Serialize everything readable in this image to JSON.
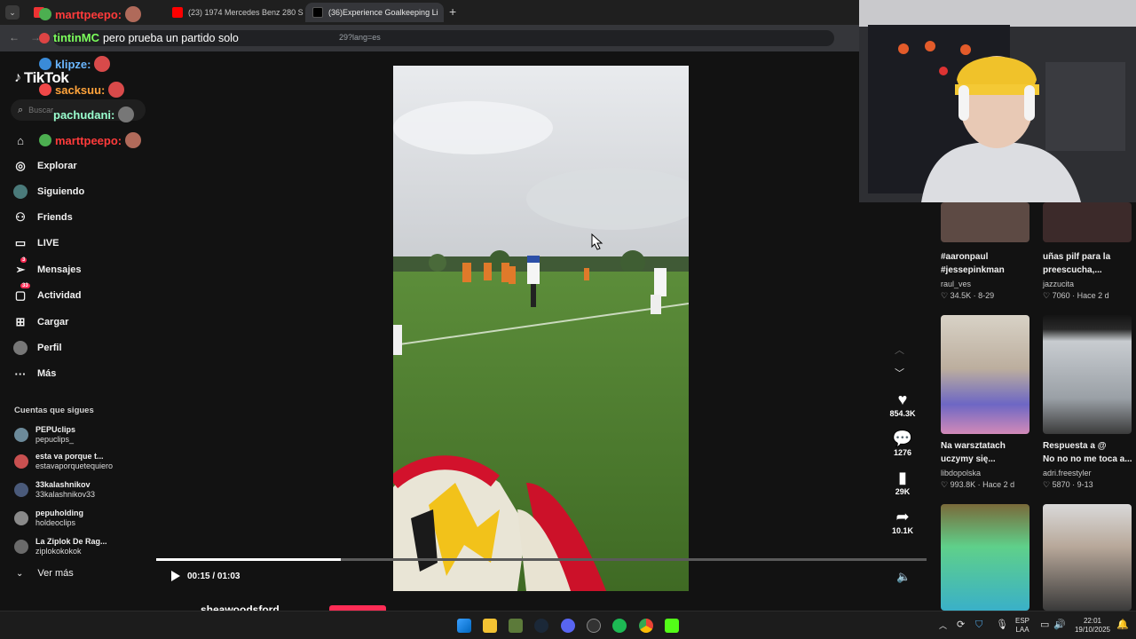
{
  "browser": {
    "tabs": [
      {
        "label": "(23) 1974 Mercedes Benz 280 S",
        "active": false
      },
      {
        "label": "(36)Experience Goalkeeping Li",
        "active": true
      }
    ],
    "new_tab": "+",
    "url_suffix": "29?lang=es"
  },
  "chat": [
    {
      "user": "marttpeepo:",
      "color": "#ff3b3b",
      "message": ""
    },
    {
      "user": "tintinMC",
      "color": "#7cff5c",
      "message": "pero prueba un partido solo"
    },
    {
      "user": "klipze:",
      "color": "#6bb7ff",
      "message": ""
    },
    {
      "user": "sacksuu:",
      "color": "#ffa33b",
      "message": ""
    },
    {
      "user": "pachudani:",
      "color": "#9affcf",
      "message": ""
    },
    {
      "user": "marttpeepo:",
      "color": "#ff3b3b",
      "message": ""
    }
  ],
  "sidebar": {
    "logo": "TikTok",
    "search_placeholder": "Buscar",
    "items": [
      {
        "label": "",
        "icon": "home-icon"
      },
      {
        "label": "Explorar",
        "icon": "compass-icon"
      },
      {
        "label": "Siguiendo",
        "icon": "following-icon"
      },
      {
        "label": "Friends",
        "icon": "friends-icon"
      },
      {
        "label": "LIVE",
        "icon": "live-icon"
      },
      {
        "label": "Mensajes",
        "icon": "messages-icon",
        "badge": "3"
      },
      {
        "label": "Actividad",
        "icon": "activity-icon",
        "badge": "33"
      },
      {
        "label": "Cargar",
        "icon": "upload-icon"
      },
      {
        "label": "Perfil",
        "icon": "profile-icon"
      },
      {
        "label": "Más",
        "icon": "more-icon"
      }
    ],
    "following_header": "Cuentas que sigues",
    "following": [
      {
        "name": "PEPUclips",
        "handle": "pepuclips_"
      },
      {
        "name": "esta va porque t...",
        "handle": "estavaporquetequiero"
      },
      {
        "name": "33kalashnikov",
        "handle": "33kalashnikov33"
      },
      {
        "name": "pepuholding",
        "handle": "holdeoclips"
      },
      {
        "name": "La Ziplok De Rag...",
        "handle": "ziplokokokok"
      }
    ],
    "see_more": "Ver más"
  },
  "player": {
    "time": "00:15 / 01:03",
    "progress": 0.24,
    "author": "sheawoodsford"
  },
  "actions": {
    "likes": "854.3K",
    "comments": "1276",
    "saves": "29K",
    "shares": "10.1K"
  },
  "recommended": [
    {
      "title_lines": [
        "#aaronpaul",
        "#jessepinkman"
      ],
      "author": "raul_ves",
      "likes": "34.5K",
      "date": "8-29"
    },
    {
      "title_lines": [
        "uñas pilf para la",
        "preescucha,..."
      ],
      "author": "jazzucita",
      "likes": "7060",
      "date": "Hace 2 d"
    },
    {
      "title_lines": [
        "Na warsztatach",
        "uczymy się..."
      ],
      "author": "libdopolska",
      "likes": "993.8K",
      "date": "Hace 2 d"
    },
    {
      "title_lines": [
        "Respuesta a @",
        "No no no me toca a..."
      ],
      "author": "adri.freestyler",
      "likes": "5870",
      "date": "9-13"
    }
  ],
  "taskbar": {
    "lang": "ESP",
    "layout": "LAA",
    "time": "22:01",
    "date": "19/10/2025"
  }
}
